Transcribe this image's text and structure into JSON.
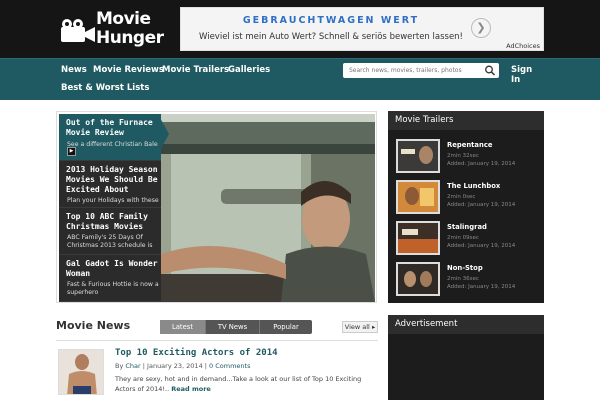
{
  "logo": {
    "line1": "Movie",
    "line2": "Hunger"
  },
  "ad": {
    "title": "GEBRAUCHTWAGEN WERT",
    "text": "Wieviel ist mein Auto Wert? Schnell & seriös bewerten lassen!",
    "choices": "AdChoices"
  },
  "nav": {
    "items": [
      "News",
      "Movie Reviews",
      "Movie Trailers",
      "Galleries",
      "Best & Worst Lists"
    ],
    "search_placeholder": "Search news, movies, trailers, photos",
    "signin": "Sign In"
  },
  "featured": [
    {
      "title": "Out of the Furnace Movie Review",
      "sub": "See a different Christian Bale"
    },
    {
      "title": "2013 Holiday Season Movies We Should Be Excited About",
      "sub": "Plan your Holidays with these"
    },
    {
      "title": "Top 10 ABC Family Christmas Movies",
      "sub": "ABC Family's 25 Days Of Christmas 2013 schedule is"
    },
    {
      "title": "Gal Gadot Is Wonder Woman",
      "sub": "Fast & Furious Hottie is now a superhero"
    }
  ],
  "news": {
    "heading": "Movie News",
    "tabs": [
      "Latest",
      "TV News",
      "Popular"
    ],
    "view_all": "View all",
    "article": {
      "title": "Top 10 Exciting Actors of 2014",
      "by": "By",
      "author": "Char",
      "date": "January 23, 2014",
      "comments": "0 Comments",
      "excerpt": "They are sexy, hot and in demand...Take a look at our list of Top 10 Exciting Actors of 2014!..",
      "read_more": "Read more"
    }
  },
  "trailers": {
    "heading": "Movie Trailers",
    "items": [
      {
        "title": "Repentance",
        "duration": "2min 32sec",
        "added": "Added: January 19, 2014"
      },
      {
        "title": "The Lunchbox",
        "duration": "2min 0sec",
        "added": "Added: January 19, 2014"
      },
      {
        "title": "Stalingrad",
        "duration": "2min 09sec",
        "added": "Added: January 19, 2014"
      },
      {
        "title": "Non-Stop",
        "duration": "2min 36sec",
        "added": "Added: January 19, 2014"
      }
    ]
  },
  "advertisement": {
    "heading": "Advertisement"
  }
}
